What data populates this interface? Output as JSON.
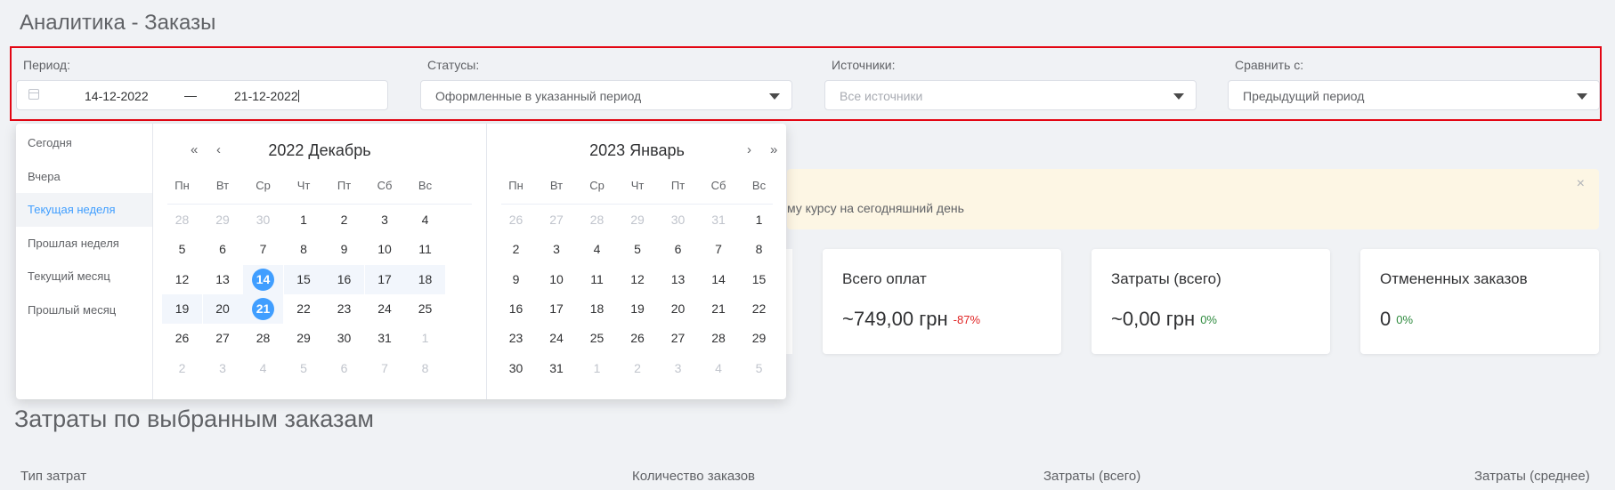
{
  "page": {
    "title": "Аналитика - Заказы"
  },
  "filters": {
    "period": {
      "label": "Период:",
      "start": "14-12-2022",
      "separator": "—",
      "end": "21-12-2022"
    },
    "statuses": {
      "label": "Статусы:",
      "value": "Оформленные в указанный период"
    },
    "sources": {
      "label": "Источники:",
      "placeholder": "Все источники"
    },
    "compare": {
      "label": "Сравнить с:",
      "value": "Предыдущий период"
    }
  },
  "picker": {
    "shortcuts": [
      {
        "label": "Сегодня",
        "active": false
      },
      {
        "label": "Вчера",
        "active": false
      },
      {
        "label": "Текущая неделя",
        "active": true
      },
      {
        "label": "Прошлая неделя",
        "active": false
      },
      {
        "label": "Текущий месяц",
        "active": false
      },
      {
        "label": "Прошлый месяц",
        "active": false
      }
    ],
    "weekdays": [
      "Пн",
      "Вт",
      "Ср",
      "Чт",
      "Пт",
      "Сб",
      "Вс"
    ],
    "nav": {
      "prev_year": "«",
      "prev_month": "‹",
      "next_month": "›",
      "next_year": "»"
    },
    "months": [
      {
        "title": "2022 Декабрь",
        "weeks": [
          [
            28,
            29,
            30,
            1,
            2,
            3,
            4
          ],
          [
            5,
            6,
            7,
            8,
            9,
            10,
            11
          ],
          [
            12,
            13,
            14,
            15,
            16,
            17,
            18
          ],
          [
            19,
            20,
            21,
            22,
            23,
            24,
            25
          ],
          [
            26,
            27,
            28,
            29,
            30,
            31,
            1
          ],
          [
            2,
            3,
            4,
            5,
            6,
            7,
            8
          ]
        ],
        "other_month_days": [
          [
            0,
            0
          ],
          [
            0,
            1
          ],
          [
            0,
            2
          ],
          [
            4,
            6
          ],
          [
            5,
            0
          ],
          [
            5,
            1
          ],
          [
            5,
            2
          ],
          [
            5,
            3
          ],
          [
            5,
            4
          ],
          [
            5,
            5
          ],
          [
            5,
            6
          ]
        ],
        "range_start": [
          2,
          2
        ],
        "range_end": [
          3,
          2
        ]
      },
      {
        "title": "2023 Январь",
        "weeks": [
          [
            26,
            27,
            28,
            29,
            30,
            31,
            1
          ],
          [
            2,
            3,
            4,
            5,
            6,
            7,
            8
          ],
          [
            9,
            10,
            11,
            12,
            13,
            14,
            15
          ],
          [
            16,
            17,
            18,
            19,
            20,
            21,
            22
          ],
          [
            23,
            24,
            25,
            26,
            27,
            28,
            29
          ],
          [
            30,
            31,
            1,
            2,
            3,
            4,
            5
          ]
        ],
        "other_month_days": [
          [
            0,
            0
          ],
          [
            0,
            1
          ],
          [
            0,
            2
          ],
          [
            0,
            3
          ],
          [
            0,
            4
          ],
          [
            0,
            5
          ],
          [
            5,
            2
          ],
          [
            5,
            3
          ],
          [
            5,
            4
          ],
          [
            5,
            5
          ],
          [
            5,
            6
          ]
        ]
      }
    ]
  },
  "alert": {
    "text": "му курсу на сегодняшний день",
    "close": "×"
  },
  "cards": [
    {
      "title": "Всего оплат",
      "value": "~749,00 грн",
      "change": "-87%",
      "trend": "neg"
    },
    {
      "title": "Затраты (всего)",
      "value": "~0,00 грн",
      "change": "0%",
      "trend": "zero"
    },
    {
      "title": "Отмененных заказов",
      "value": "0",
      "change": "0%",
      "trend": "zero"
    }
  ],
  "costs": {
    "title": "Затраты по выбранным заказам",
    "columns": [
      "Тип затрат",
      "Количество заказов",
      "Затраты (всего)",
      "Затраты (среднее)"
    ]
  },
  "colors": {
    "accent": "#409eff",
    "highlight": "#e30613",
    "negative": "#e02424",
    "positive": "#2e8a3e"
  }
}
